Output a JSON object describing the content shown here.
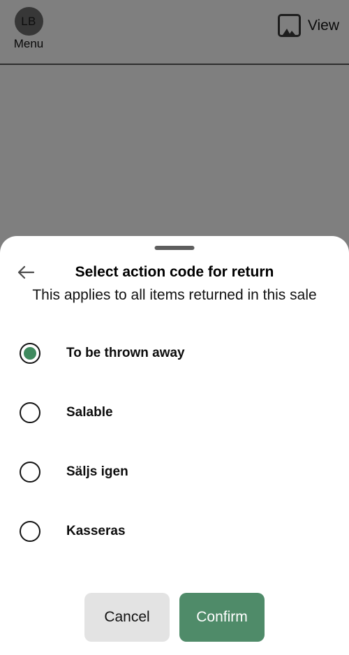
{
  "colors": {
    "accent_green": "#4f8b69",
    "radio_selected_fill": "#3f8a5e",
    "cancel_gray": "#e3e3e3",
    "scrim": "rgba(0,0,0,0.5)",
    "sheet_bg": "#ffffff"
  },
  "topbar": {
    "avatar_initials": "LB",
    "menu_label": "Menu",
    "view_label": "View",
    "view_icon": "image-icon"
  },
  "sheet": {
    "grabber": "drag-handle",
    "back_icon": "arrow-left-icon",
    "title": "Select action code for return",
    "subtitle": "This applies to all items returned in this sale",
    "options": [
      {
        "label": "To be thrown away",
        "selected": true
      },
      {
        "label": "Salable",
        "selected": false
      },
      {
        "label": "Säljs igen",
        "selected": false
      },
      {
        "label": "Kasseras",
        "selected": false
      }
    ],
    "actions": {
      "cancel_label": "Cancel",
      "confirm_label": "Confirm"
    }
  }
}
